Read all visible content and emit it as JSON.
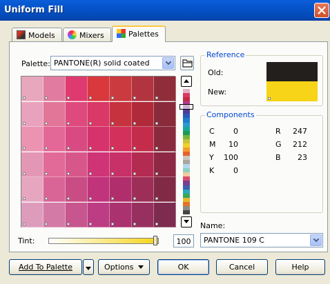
{
  "window": {
    "title": "Uniform Fill"
  },
  "tabs": [
    {
      "label": "Models",
      "active": false
    },
    {
      "label": "Mixers",
      "active": false
    },
    {
      "label": "Palettes",
      "active": true
    }
  ],
  "palette": {
    "label": "Palette:",
    "selected": "PANTONE(R) solid coated"
  },
  "reference": {
    "title": "Reference",
    "old_label": "Old:",
    "new_label": "New:",
    "old_color": "#231f1c",
    "new_color": "#f7d417"
  },
  "components": {
    "title": "Components",
    "cmyk": [
      {
        "k": "C",
        "v": "0"
      },
      {
        "k": "M",
        "v": "10"
      },
      {
        "k": "Y",
        "v": "100"
      },
      {
        "k": "K",
        "v": "0"
      }
    ],
    "rgb": [
      {
        "k": "R",
        "v": "247"
      },
      {
        "k": "G",
        "v": "212"
      },
      {
        "k": "B",
        "v": "23"
      }
    ]
  },
  "name_field": {
    "label": "Name:",
    "value": "PANTONE 109 C"
  },
  "tint": {
    "label": "Tint:",
    "value": "100"
  },
  "buttons": {
    "add_to_palette": "Add To Palette",
    "options": "Options",
    "ok": "OK",
    "cancel": "Cancel",
    "help": "Help"
  },
  "swatch_colors": [
    [
      "#e7a7bd",
      "#e27ba0",
      "#df3a6f",
      "#d9383d",
      "#cb3a3f",
      "#b23440",
      "#8f2e39"
    ],
    [
      "#e9a2be",
      "#e17699",
      "#de4a7d",
      "#da3866",
      "#c6323e",
      "#b02a3a",
      "#892b3a"
    ],
    [
      "#ec93b2",
      "#e46897",
      "#d94a82",
      "#d6336c",
      "#d3305b",
      "#c42c4c",
      "#8a2a3e"
    ],
    [
      "#e497b5",
      "#e26a98",
      "#d8578b",
      "#cf3476",
      "#c73168",
      "#b42b52",
      "#8d2943"
    ],
    [
      "#e6a6c0",
      "#d96597",
      "#c94c85",
      "#c1337b",
      "#b02e6b",
      "#9c2e58",
      "#812a46"
    ],
    [
      "#de9cbc",
      "#d47aa6",
      "#c7568e",
      "#bd3d84",
      "#a9326f",
      "#98305f",
      "#7d2b4e"
    ]
  ],
  "strip_colors": [
    "#e2b0c0",
    "#d9385f",
    "#c22c43",
    "#b33a8e",
    "#7b3e9c",
    "#4d3d97",
    "#2a59b8",
    "#1f7bc7",
    "#2d99d0",
    "#19a69a",
    "#1e9a54",
    "#79b63b",
    "#c9c23a",
    "#f0d02a",
    "#f39b2e",
    "#e5622b",
    "#c9c7c0",
    "#a8a6a0",
    "#b6d6ea",
    "#8ed0c0",
    "#f2c8a0",
    "#d84a6a",
    "#7a3d8c",
    "#3e5fb0",
    "#2aa7b8",
    "#3aa557",
    "#e4b92c",
    "#e27429",
    "#8c8a85",
    "#444444"
  ]
}
